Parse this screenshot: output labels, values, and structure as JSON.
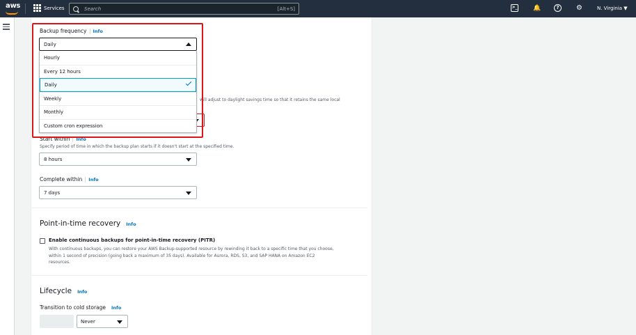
{
  "nav": {
    "logo": "aws",
    "services_label": "Services",
    "search_placeholder": "Search",
    "search_shortcut": "[Alt+S]",
    "cloudshell_glyph": ">_",
    "bell_glyph": "🔔",
    "help_glyph": "?",
    "gear_glyph": "⚙",
    "region": "N. Virginia ▼"
  },
  "backup_frequency": {
    "label": "Backup frequency",
    "info": "Info",
    "selected": "Daily",
    "options": [
      "Hourly",
      "Every 12 hours",
      "Daily",
      "Weekly",
      "Monthly",
      "Custom cron expression"
    ]
  },
  "daylight_note": "will adjust to daylight savings time so that it retains the same local",
  "start_within": {
    "label": "Start within",
    "info": "Info",
    "description": "Specify period of time in which the backup plan starts if it doesn't start at the specified time.",
    "value": "8 hours"
  },
  "complete_within": {
    "label": "Complete within",
    "info": "Info",
    "value": "7 days"
  },
  "pitr": {
    "heading": "Point-in-time recovery",
    "info": "Info",
    "checkbox_label": "Enable continuous backups for point-in-time recovery (PITR)",
    "description": [
      "With continuous backups, you can restore your AWS Backup-supported resource by rewinding it back to a specific time that you choose,",
      "within 1 second of precision (going back a maximum of 35 days). Available for Aurora, RDS, S3, and SAP HANA on Amazon EC2",
      "resources."
    ]
  },
  "lifecycle": {
    "heading": "Lifecycle",
    "info": "Info",
    "cold_storage_label": "Transition to cold storage",
    "cold_storage_info": "Info",
    "cold_storage_value": "Never"
  },
  "colors": {
    "nav_bg": "#232f3e",
    "link": "#0073bb",
    "highlight_outline": "#d91515",
    "logo_smile": "#ff9900"
  }
}
